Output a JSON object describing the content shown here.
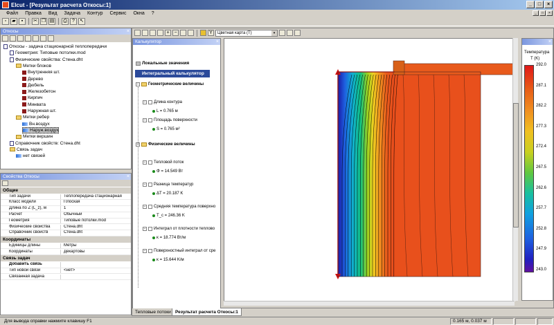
{
  "window": {
    "title": "Elcut - [Результат расчета Откосы:1]"
  },
  "menu": [
    "Файл",
    "Правка",
    "Вид",
    "Задача",
    "Контур",
    "Сервис",
    "Окна",
    "?"
  ],
  "tree_panel": {
    "title": "Откосы",
    "nodes": [
      {
        "label": "Откосы - задача стационарной теплопередачи",
        "indent": 0,
        "icon": "doc"
      },
      {
        "label": "Геометрия: Типовые потолки.mod",
        "indent": 1,
        "icon": "doc"
      },
      {
        "label": "Физические свойства: Стена.dht",
        "indent": 1,
        "icon": "doc"
      },
      {
        "label": "Метки блоков",
        "indent": 2,
        "icon": "folder"
      },
      {
        "label": "Внутренняя шт.",
        "indent": 3,
        "icon": "mat"
      },
      {
        "label": "Дерево",
        "indent": 3,
        "icon": "mat"
      },
      {
        "label": "Дюбель",
        "indent": 3,
        "icon": "mat"
      },
      {
        "label": "Железобетон",
        "indent": 3,
        "icon": "mat"
      },
      {
        "label": "Кирпич",
        "indent": 3,
        "icon": "mat"
      },
      {
        "label": "Минвата",
        "indent": 3,
        "icon": "mat"
      },
      {
        "label": "Наружная шт.",
        "indent": 3,
        "icon": "mat"
      },
      {
        "label": "Метки ребер",
        "indent": 2,
        "icon": "folder"
      },
      {
        "label": "Вн.воздух",
        "indent": 3,
        "icon": "bc"
      },
      {
        "label": "Наруж.воздух",
        "indent": 3,
        "icon": "bc",
        "selected": true
      },
      {
        "label": "Метки вершин",
        "indent": 2,
        "icon": "folder"
      },
      {
        "label": "Справочник свойств: Стена.dht",
        "indent": 1,
        "icon": "doc"
      },
      {
        "label": "Связь задач",
        "indent": 1,
        "icon": "folder"
      },
      {
        "label": "нет связей",
        "indent": 2,
        "icon": "bc"
      }
    ]
  },
  "props_panel": {
    "title": "Свойства Откосы",
    "sections": [
      {
        "name": "Общие",
        "rows": [
          {
            "k": "Тип задачи",
            "v": "Теплопередача стационарная"
          },
          {
            "k": "Класс модели",
            "v": "Плоская"
          },
          {
            "k": "Длина по Z (L_z), м",
            "v": "1"
          },
          {
            "k": "Расчет",
            "v": "Обычный"
          },
          {
            "k": "Геометрия",
            "v": "Типовые потолки.mod"
          },
          {
            "k": "Физические свойства",
            "v": "Стена.dht"
          },
          {
            "k": "Справочник свойств",
            "v": "Стена.dht"
          }
        ]
      },
      {
        "name": "Координаты",
        "rows": [
          {
            "k": "Единицы длины",
            "v": "Метры"
          },
          {
            "k": "Координаты",
            "v": "Декартовы"
          }
        ]
      },
      {
        "name": "Связь задач",
        "rows": [
          {
            "k": "Добавить связь",
            "v": "",
            "bold": true
          },
          {
            "k": "Тип новой связи",
            "v": "<нет>"
          },
          {
            "k": "Связанная задача",
            "v": ""
          }
        ]
      }
    ]
  },
  "doc_toolbar": {
    "mode": "Цветная карта (Т)"
  },
  "calculator": {
    "title": "Калькулятор",
    "local_values": "Локальные значения",
    "integral": "Интегральный калькулятор",
    "geom_group": "Геометрические величины",
    "phys_group": "Физические величины",
    "items": [
      {
        "label": "Длина контура",
        "value": "L = 0.765 м"
      },
      {
        "label": "Площадь поверхности",
        "value": "S = 0.765 м²"
      },
      {
        "label": "Тепловой поток",
        "value": "Φ = 14.549 Вт"
      },
      {
        "label": "Разница температур",
        "value": "ΔT = 20.187 K"
      },
      {
        "label": "Средняя температура поверхно",
        "value": "T_c = 246.36 K"
      },
      {
        "label": "Интеграл от плотности теплово",
        "value": "κ = 18.774 Вт/м"
      },
      {
        "label": "Поверхностный интеграл от сре",
        "value": "κ = 15.644 K/м"
      }
    ]
  },
  "legend": {
    "title_line1": "Температура",
    "title_line2": "T (K)",
    "ticks": [
      "292.0",
      "287.1",
      "282.2",
      "277.3",
      "272.4",
      "267.5",
      "262.6",
      "257.7",
      "252.8",
      "247.9",
      "243.0"
    ]
  },
  "tabs": [
    "Тепловые потоки",
    "Результат расчета Откосы:1"
  ],
  "status": {
    "hint": "Для вывода справки нажмите клавишу F1",
    "coords": "0.165 м, 0.037 м"
  },
  "colors": {
    "accent": "#0a246a",
    "hot": "#e84b1c",
    "cold": "#1a1aa6"
  }
}
